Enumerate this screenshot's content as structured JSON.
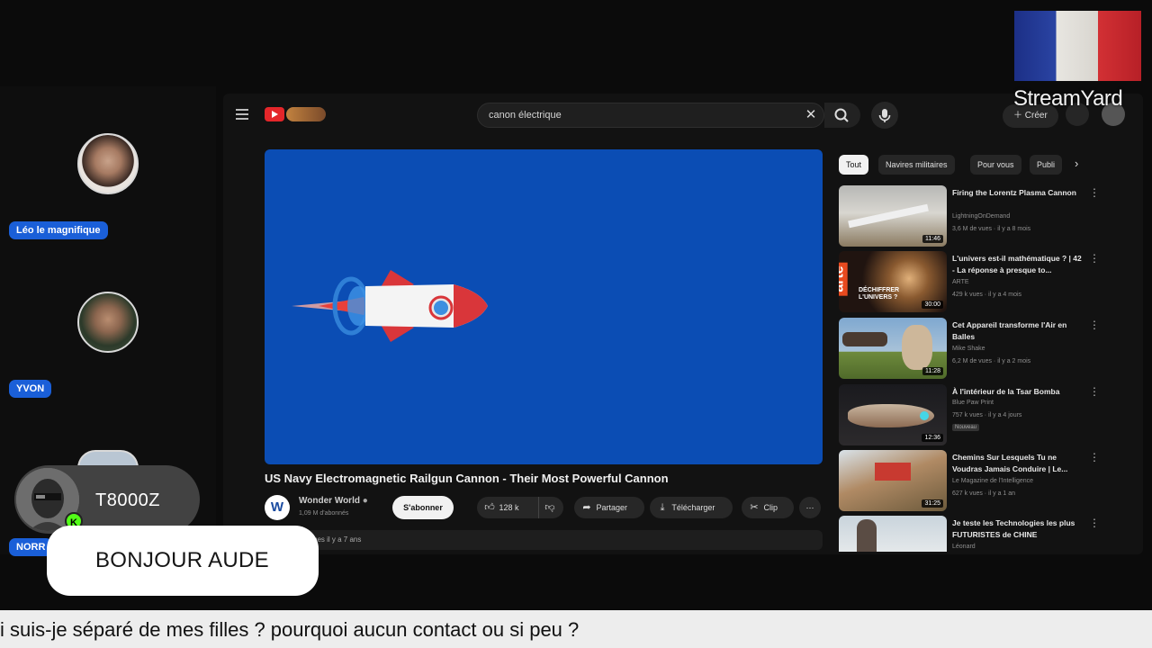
{
  "participants": [
    {
      "name": "Léo le magnifique"
    },
    {
      "name": "YVON"
    },
    {
      "name": "NORR"
    }
  ],
  "youtube": {
    "search_query": "canon électrique",
    "create_label": "Créer",
    "video": {
      "title": "US Navy Electromagnetic Railgun Cannon - Their Most Powerful Cannon",
      "channel": "Wonder World",
      "channel_initial": "W",
      "subscribers": "1,09 M d'abonnés",
      "subscribe_label": "S'abonner",
      "likes": "128 k",
      "share_label": "Partager",
      "download_label": "Télécharger",
      "clip_label": "Clip",
      "description_meta": "vues  il y a 7 ans"
    },
    "chips": [
      "Tout",
      "Navires militaires",
      "Pour vous",
      "Publi"
    ],
    "recommendations": [
      {
        "title": "Firing the Lorentz Plasma Cannon",
        "channel": "LightningOnDemand",
        "meta": "3,6 M de vues · il y a 8 mois",
        "duration": "11:46"
      },
      {
        "title": "L'univers est-il mathématique ? | 42 - La réponse à presque to...",
        "channel": "ARTE",
        "meta": "429 k vues · il y a 4 mois",
        "duration": "30:00",
        "thumb_text": "arte",
        "thumb_caption": "DÉCHIFFRER L'UNIVERS ?"
      },
      {
        "title": "Cet Appareil transforme l'Air en Balles",
        "channel": "Mike Shake",
        "meta": "6,2 M de vues · il y a 2 mois",
        "duration": "11:28"
      },
      {
        "title": "À l'intérieur de la Tsar Bomba",
        "channel": "Blue Paw Print",
        "meta": "757 k vues · il y a 4 jours",
        "duration": "12:36",
        "badge": "Nouveau"
      },
      {
        "title": "Chemins Sur Lesquels Tu ne Voudras Jamais Conduire | Le...",
        "channel": "Le Magazine de l'Intelligence",
        "meta": "627 k vues · il y a 1 an",
        "duration": "31:25"
      },
      {
        "title": "Je teste les Technologies les plus FUTURISTES de CHINE",
        "channel": "Léonard",
        "meta": "",
        "duration": ""
      }
    ]
  },
  "overlay": {
    "brand": "StreamYard",
    "commenter_name": "T8000Z",
    "platform_badge": "K",
    "comment": "BONJOUR AUDE",
    "ticker": "i suis-je séparé de mes filles ? pourquoi aucun contact ou si peu ?"
  },
  "colors": {
    "name_tag": "#1a5fd8",
    "player_bg": "#0b4db4",
    "badge_green": "#53fc18"
  }
}
